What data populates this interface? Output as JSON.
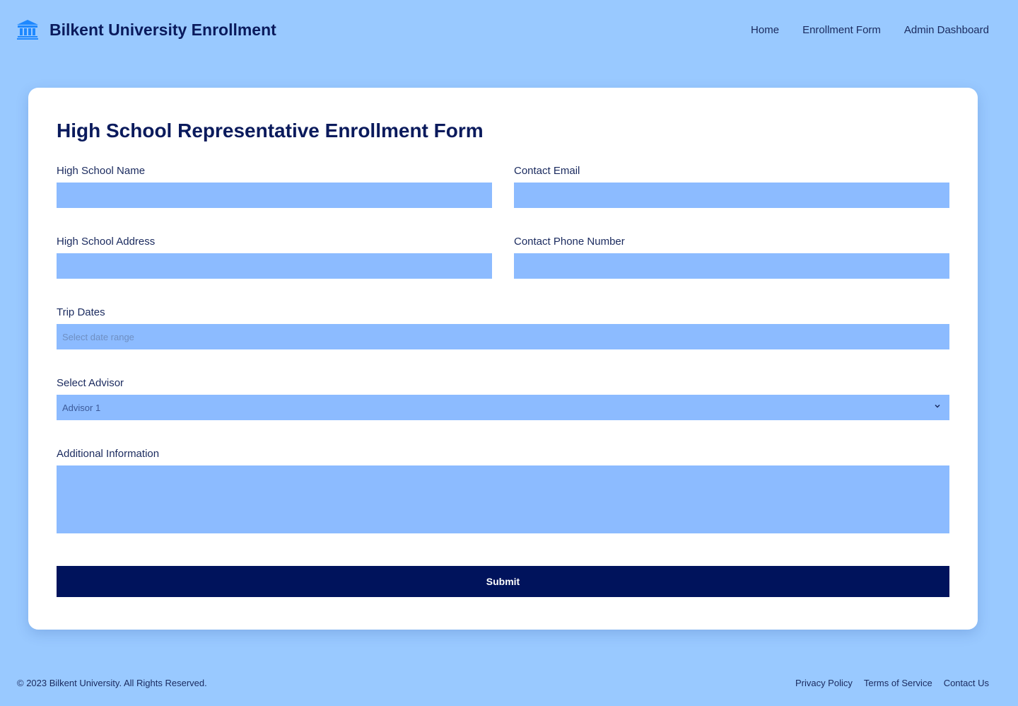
{
  "header": {
    "brand_icon": "university-building-icon",
    "brand_icon_color": "#1e88ff",
    "title": "Bilkent University Enrollment",
    "nav": [
      "Home",
      "Enrollment Form",
      "Admin Dashboard"
    ]
  },
  "form": {
    "title": "High School Representative Enrollment Form",
    "fields": {
      "high_school_name": {
        "label": "High School Name",
        "value": ""
      },
      "contact_email": {
        "label": "Contact Email",
        "value": ""
      },
      "high_school_address": {
        "label": "High School Address",
        "value": ""
      },
      "contact_phone": {
        "label": "Contact Phone Number",
        "value": ""
      },
      "trip_dates": {
        "label": "Trip Dates",
        "placeholder": "Select date range",
        "value": ""
      },
      "advisor": {
        "label": "Select Advisor",
        "selected": "Advisor 1"
      },
      "additional_info": {
        "label": "Additional Information",
        "value": ""
      }
    },
    "submit_label": "Submit"
  },
  "footer": {
    "copyright": "© 2023 Bilkent University. All Rights Reserved.",
    "links": [
      "Privacy Policy",
      "Terms of Service",
      "Contact Us"
    ]
  },
  "colors": {
    "page_background": "#99c9ff",
    "input_background": "#8cbbff",
    "primary": "#00135c",
    "card": "#ffffff"
  }
}
